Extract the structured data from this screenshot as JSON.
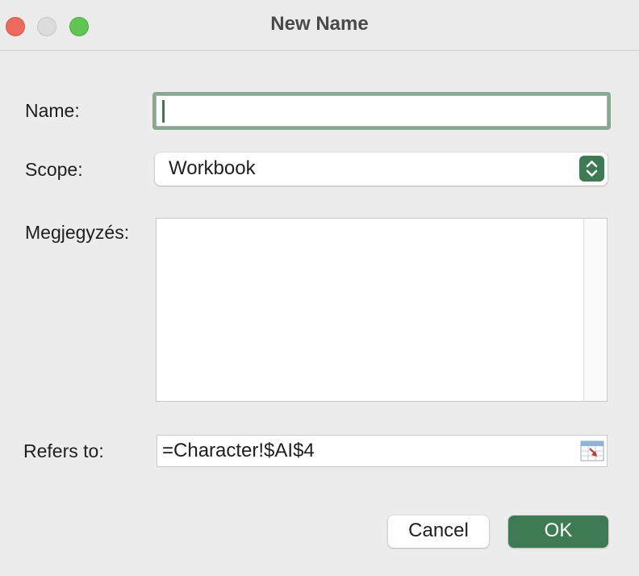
{
  "window": {
    "title": "New Name"
  },
  "form": {
    "name_label": "Name:",
    "name_value": "",
    "scope_label": "Scope:",
    "scope_value": "Workbook",
    "comment_label": "Megjegyzés:",
    "comment_value": "",
    "refers_label": "Refers to:",
    "refers_value": "=Character!$AI$4"
  },
  "buttons": {
    "cancel": "Cancel",
    "ok": "OK"
  },
  "colors": {
    "accent": "#3e7b55",
    "focus_ring": "#8aa891",
    "close": "#ee6a5f",
    "minimize": "#dcdcdc",
    "maximize": "#61c554"
  },
  "icons": {
    "scope_stepper": "up-down-chevron-icon",
    "refers_collapse": "range-select-icon"
  }
}
